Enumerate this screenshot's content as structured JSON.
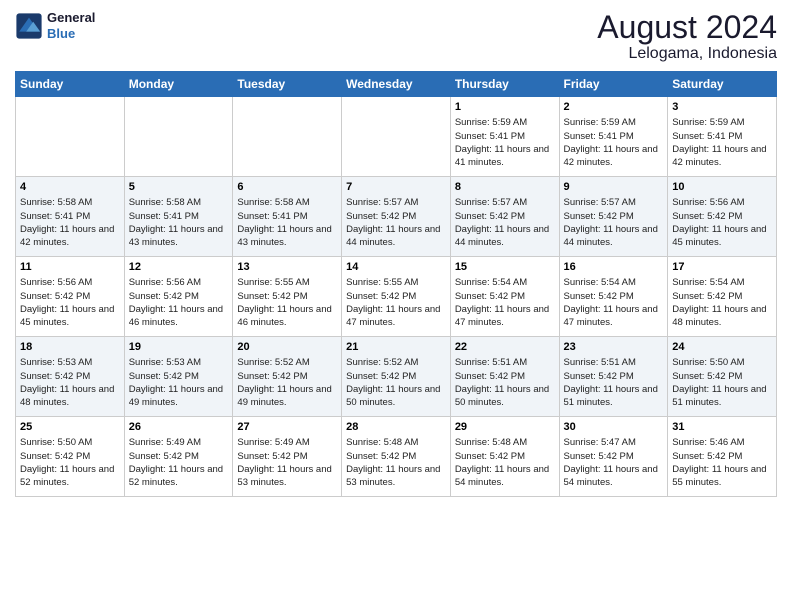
{
  "logo": {
    "text_general": "General",
    "text_blue": "Blue"
  },
  "title": "August 2024",
  "subtitle": "Lelogama, Indonesia",
  "days_of_week": [
    "Sunday",
    "Monday",
    "Tuesday",
    "Wednesday",
    "Thursday",
    "Friday",
    "Saturday"
  ],
  "weeks": [
    [
      {
        "day": "",
        "detail": ""
      },
      {
        "day": "",
        "detail": ""
      },
      {
        "day": "",
        "detail": ""
      },
      {
        "day": "",
        "detail": ""
      },
      {
        "day": "1",
        "detail": "Sunrise: 5:59 AM\nSunset: 5:41 PM\nDaylight: 11 hours and 41 minutes."
      },
      {
        "day": "2",
        "detail": "Sunrise: 5:59 AM\nSunset: 5:41 PM\nDaylight: 11 hours and 42 minutes."
      },
      {
        "day": "3",
        "detail": "Sunrise: 5:59 AM\nSunset: 5:41 PM\nDaylight: 11 hours and 42 minutes."
      }
    ],
    [
      {
        "day": "4",
        "detail": "Sunrise: 5:58 AM\nSunset: 5:41 PM\nDaylight: 11 hours and 42 minutes."
      },
      {
        "day": "5",
        "detail": "Sunrise: 5:58 AM\nSunset: 5:41 PM\nDaylight: 11 hours and 43 minutes."
      },
      {
        "day": "6",
        "detail": "Sunrise: 5:58 AM\nSunset: 5:41 PM\nDaylight: 11 hours and 43 minutes."
      },
      {
        "day": "7",
        "detail": "Sunrise: 5:57 AM\nSunset: 5:42 PM\nDaylight: 11 hours and 44 minutes."
      },
      {
        "day": "8",
        "detail": "Sunrise: 5:57 AM\nSunset: 5:42 PM\nDaylight: 11 hours and 44 minutes."
      },
      {
        "day": "9",
        "detail": "Sunrise: 5:57 AM\nSunset: 5:42 PM\nDaylight: 11 hours and 44 minutes."
      },
      {
        "day": "10",
        "detail": "Sunrise: 5:56 AM\nSunset: 5:42 PM\nDaylight: 11 hours and 45 minutes."
      }
    ],
    [
      {
        "day": "11",
        "detail": "Sunrise: 5:56 AM\nSunset: 5:42 PM\nDaylight: 11 hours and 45 minutes."
      },
      {
        "day": "12",
        "detail": "Sunrise: 5:56 AM\nSunset: 5:42 PM\nDaylight: 11 hours and 46 minutes."
      },
      {
        "day": "13",
        "detail": "Sunrise: 5:55 AM\nSunset: 5:42 PM\nDaylight: 11 hours and 46 minutes."
      },
      {
        "day": "14",
        "detail": "Sunrise: 5:55 AM\nSunset: 5:42 PM\nDaylight: 11 hours and 47 minutes."
      },
      {
        "day": "15",
        "detail": "Sunrise: 5:54 AM\nSunset: 5:42 PM\nDaylight: 11 hours and 47 minutes."
      },
      {
        "day": "16",
        "detail": "Sunrise: 5:54 AM\nSunset: 5:42 PM\nDaylight: 11 hours and 47 minutes."
      },
      {
        "day": "17",
        "detail": "Sunrise: 5:54 AM\nSunset: 5:42 PM\nDaylight: 11 hours and 48 minutes."
      }
    ],
    [
      {
        "day": "18",
        "detail": "Sunrise: 5:53 AM\nSunset: 5:42 PM\nDaylight: 11 hours and 48 minutes."
      },
      {
        "day": "19",
        "detail": "Sunrise: 5:53 AM\nSunset: 5:42 PM\nDaylight: 11 hours and 49 minutes."
      },
      {
        "day": "20",
        "detail": "Sunrise: 5:52 AM\nSunset: 5:42 PM\nDaylight: 11 hours and 49 minutes."
      },
      {
        "day": "21",
        "detail": "Sunrise: 5:52 AM\nSunset: 5:42 PM\nDaylight: 11 hours and 50 minutes."
      },
      {
        "day": "22",
        "detail": "Sunrise: 5:51 AM\nSunset: 5:42 PM\nDaylight: 11 hours and 50 minutes."
      },
      {
        "day": "23",
        "detail": "Sunrise: 5:51 AM\nSunset: 5:42 PM\nDaylight: 11 hours and 51 minutes."
      },
      {
        "day": "24",
        "detail": "Sunrise: 5:50 AM\nSunset: 5:42 PM\nDaylight: 11 hours and 51 minutes."
      }
    ],
    [
      {
        "day": "25",
        "detail": "Sunrise: 5:50 AM\nSunset: 5:42 PM\nDaylight: 11 hours and 52 minutes."
      },
      {
        "day": "26",
        "detail": "Sunrise: 5:49 AM\nSunset: 5:42 PM\nDaylight: 11 hours and 52 minutes."
      },
      {
        "day": "27",
        "detail": "Sunrise: 5:49 AM\nSunset: 5:42 PM\nDaylight: 11 hours and 53 minutes."
      },
      {
        "day": "28",
        "detail": "Sunrise: 5:48 AM\nSunset: 5:42 PM\nDaylight: 11 hours and 53 minutes."
      },
      {
        "day": "29",
        "detail": "Sunrise: 5:48 AM\nSunset: 5:42 PM\nDaylight: 11 hours and 54 minutes."
      },
      {
        "day": "30",
        "detail": "Sunrise: 5:47 AM\nSunset: 5:42 PM\nDaylight: 11 hours and 54 minutes."
      },
      {
        "day": "31",
        "detail": "Sunrise: 5:46 AM\nSunset: 5:42 PM\nDaylight: 11 hours and 55 minutes."
      }
    ]
  ]
}
